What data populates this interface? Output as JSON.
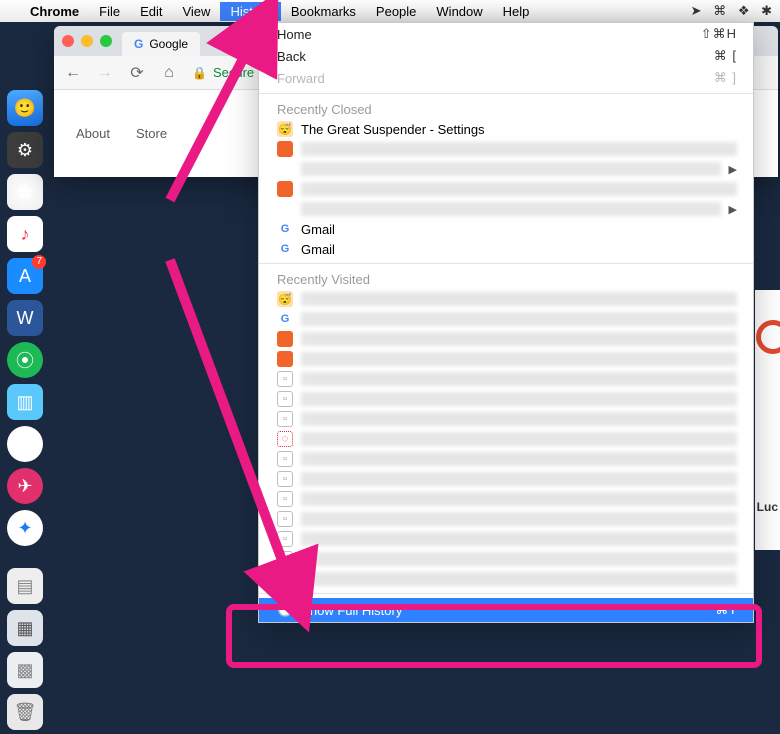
{
  "menubar": {
    "appname": "Chrome",
    "items": [
      "File",
      "Edit",
      "View",
      "History",
      "Bookmarks",
      "People",
      "Window",
      "Help"
    ],
    "active_index": 3
  },
  "dropdown": {
    "home": {
      "label": "Home",
      "shortcut": "⇧⌘H"
    },
    "back": {
      "label": "Back",
      "shortcut": "⌘ ["
    },
    "forward": {
      "label": "Forward",
      "shortcut": "⌘ ]",
      "disabled": true
    },
    "section_closed": "Recently Closed",
    "closed_items": [
      {
        "icon": "sus",
        "label": "The Great Suspender - Settings"
      },
      {
        "icon": "orange",
        "blur": true
      },
      {
        "icon": "",
        "blur": true,
        "submenu": true
      },
      {
        "icon": "orange",
        "blur": true
      },
      {
        "icon": "",
        "blur": true,
        "submenu": true
      },
      {
        "icon": "google",
        "label": "Gmail"
      },
      {
        "icon": "google",
        "label": "Gmail"
      }
    ],
    "section_visited": "Recently Visited",
    "visited_icons": [
      "sus",
      "google",
      "orange",
      "orange",
      "doc",
      "doc",
      "doc",
      "red",
      "doc",
      "doc",
      "doc",
      "doc",
      "doc",
      "doc",
      "doc"
    ],
    "show_full": {
      "label": "Show Full History",
      "shortcut": "⌘Y"
    }
  },
  "chrome": {
    "tab_title": "Google",
    "secure_label": "Secure",
    "nav_links": [
      "About",
      "Store"
    ]
  },
  "rpeek": {
    "txt": "Luc"
  },
  "dock_badge": "7"
}
